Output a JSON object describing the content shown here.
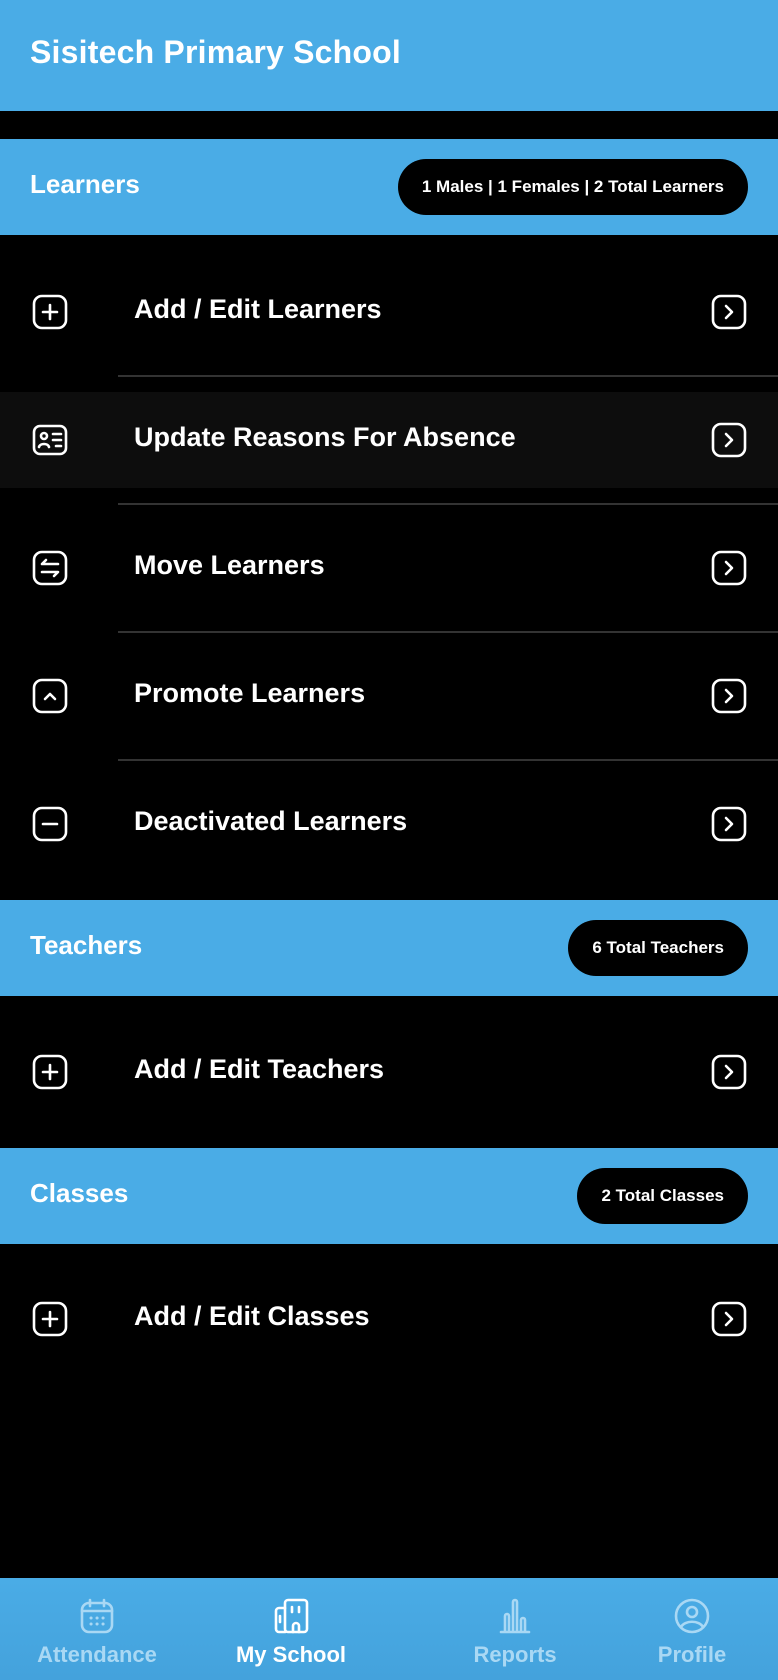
{
  "header": {
    "title": "Sisitech Primary School"
  },
  "learners": {
    "title": "Learners",
    "badge": "1 Males | 1 Females | 2 Total Learners",
    "items": [
      {
        "label": "Add / Edit Learners",
        "icon": "plus-square-icon"
      },
      {
        "label": "Update Reasons For Absence",
        "icon": "id-card-icon"
      },
      {
        "label": "Move Learners",
        "icon": "swap-arrows-icon"
      },
      {
        "label": "Promote Learners",
        "icon": "chevron-up-square-icon"
      },
      {
        "label": "Deactivated Learners",
        "icon": "minus-square-icon"
      }
    ]
  },
  "teachers": {
    "title": "Teachers",
    "badge": "6 Total Teachers",
    "items": [
      {
        "label": "Add / Edit Teachers",
        "icon": "plus-square-icon"
      }
    ]
  },
  "classes": {
    "title": "Classes",
    "badge": "2 Total Classes",
    "items": [
      {
        "label": "Add / Edit Classes",
        "icon": "plus-square-icon"
      }
    ]
  },
  "nav": {
    "tabs": [
      {
        "label": "Attendance",
        "icon": "calendar-icon"
      },
      {
        "label": "My School",
        "icon": "school-building-icon",
        "active": true
      },
      {
        "label": "Reports",
        "icon": "bar-chart-icon"
      },
      {
        "label": "Profile",
        "icon": "user-circle-icon"
      }
    ]
  },
  "colors": {
    "primary": "#4aace6",
    "background": "#000000",
    "inactive_tab": "#a9d8f4"
  }
}
